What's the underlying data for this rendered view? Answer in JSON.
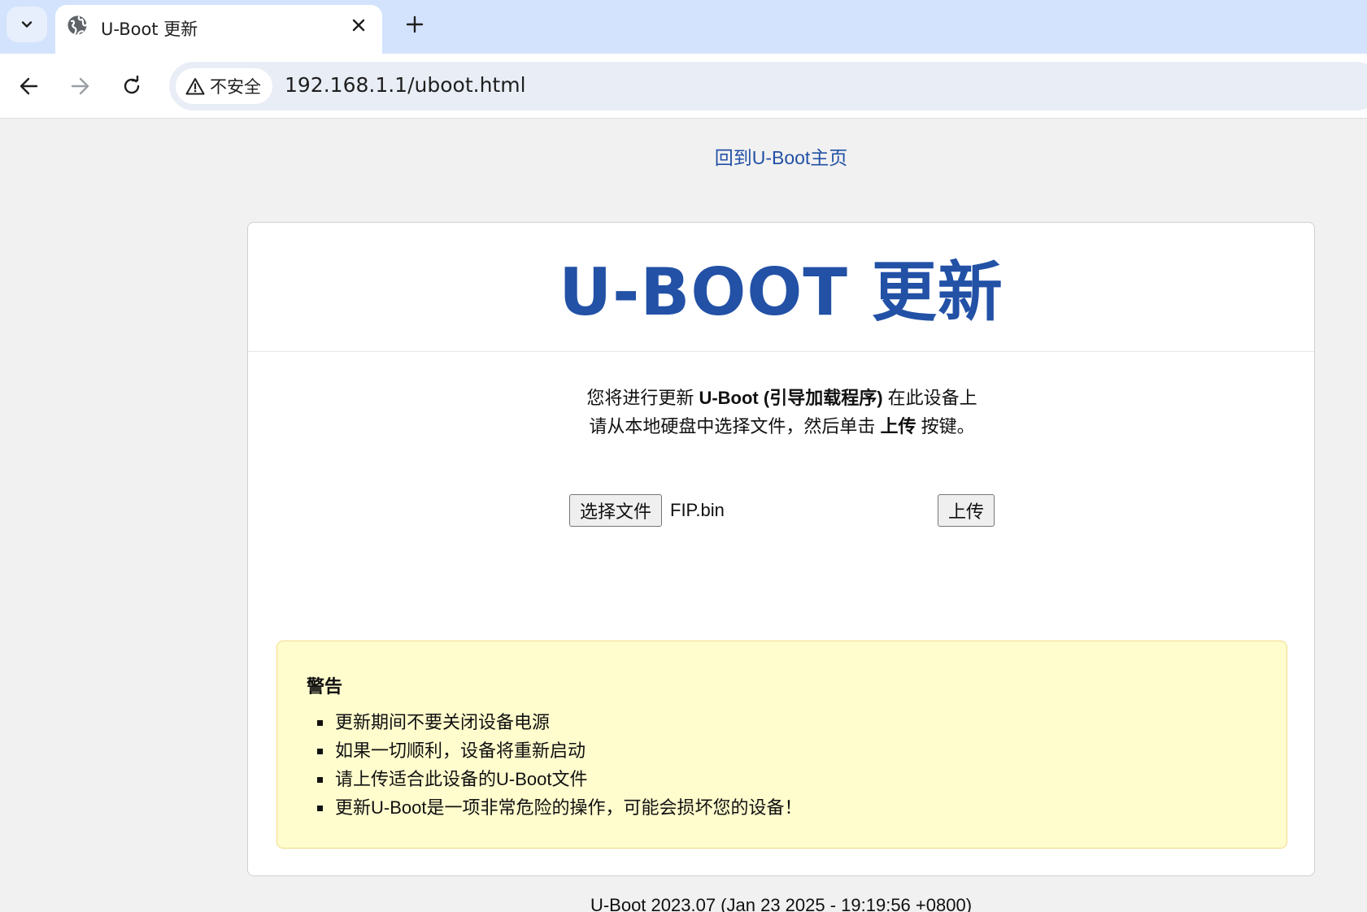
{
  "browser": {
    "tab": {
      "title": "U-Boot 更新",
      "favicon": "globe-icon"
    },
    "toolbar": {
      "security_label": "不安全",
      "security_icon": "warning-triangle-icon",
      "url": "192.168.1.1/uboot.html"
    }
  },
  "page": {
    "home_link": "回到U-Boot主页",
    "title": "U-BOOT 更新",
    "intro": {
      "line1_prefix": "您将进行更新 ",
      "line1_bold": "U-Boot (引导加载程序)",
      "line1_suffix": " 在此设备上",
      "line2_prefix": "请从本地硬盘中选择文件，然后单击 ",
      "line2_bold": "上传",
      "line2_suffix": " 按键。"
    },
    "upload": {
      "choose_file_label": "选择文件",
      "selected_file": "FIP.bin",
      "upload_label": "上传"
    },
    "warning": {
      "title": "警告",
      "items": [
        "更新期间不要关闭设备电源",
        "如果一切顺利，设备将重新启动",
        "请上传适合此设备的U-Boot文件",
        "更新U-Boot是一项非常危险的操作，可能会损坏您的设备！"
      ]
    },
    "footer": "U-Boot 2023.07 (Jan 23 2025 - 19:19:56 +0800)"
  },
  "colors": {
    "accent": "#2251a6",
    "tab_strip": "#d3e3fd",
    "omnibox": "#e9eef6",
    "page_background": "#f1f1f1",
    "warning_background": "#fffccd",
    "warning_border": "#f0dc8a"
  }
}
